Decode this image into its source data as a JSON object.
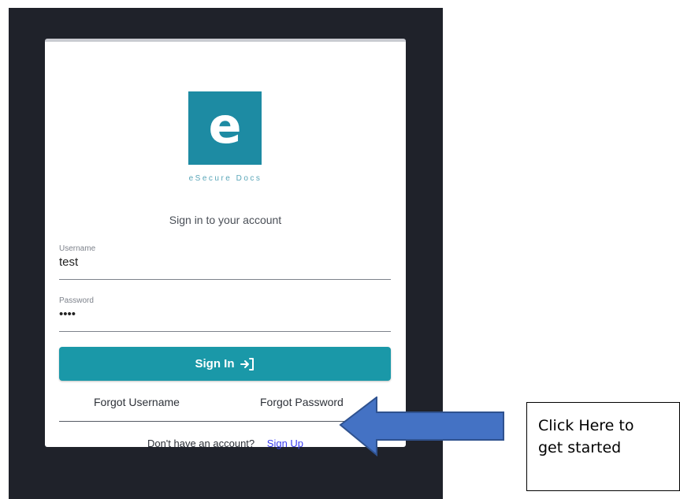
{
  "brand": {
    "logo_letter": "e",
    "name": "eSecure Docs",
    "color": "#1d8ba3"
  },
  "login": {
    "subtitle": "Sign in to your account",
    "username": {
      "label": "Username",
      "value": "test"
    },
    "password": {
      "label": "Password",
      "value": "••••"
    },
    "signin_label": "Sign In",
    "signin_icon": "login-arrow-icon",
    "forgot_username": "Forgot Username",
    "forgot_password": "Forgot Password",
    "no_account_text": "Don't have an account?",
    "signup_label": "Sign Up"
  },
  "callout": {
    "line1": "Click Here to",
    "line2": "get started",
    "arrow_color": "#4472c4"
  }
}
